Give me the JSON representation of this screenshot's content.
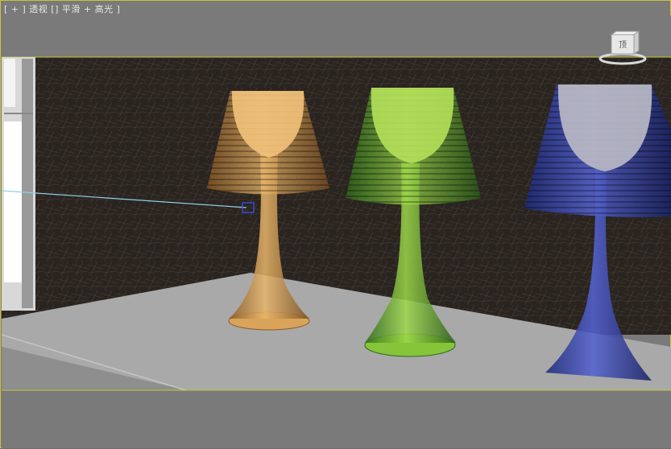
{
  "viewport": {
    "label": "[ + ] 透视 [] 平滑 + 高光 ]",
    "active_border_color": "#c8c43a"
  },
  "viewcube": {
    "icon": "viewcube-icon",
    "face_label": "顶"
  },
  "scene": {
    "objects": [
      {
        "name": "lamp-orange",
        "color": "#d9a45a"
      },
      {
        "name": "lamp-green",
        "color": "#86c43a"
      },
      {
        "name": "lamp-blue",
        "color": "#4050b8"
      }
    ],
    "light_target_color": "#8fd0e8"
  }
}
